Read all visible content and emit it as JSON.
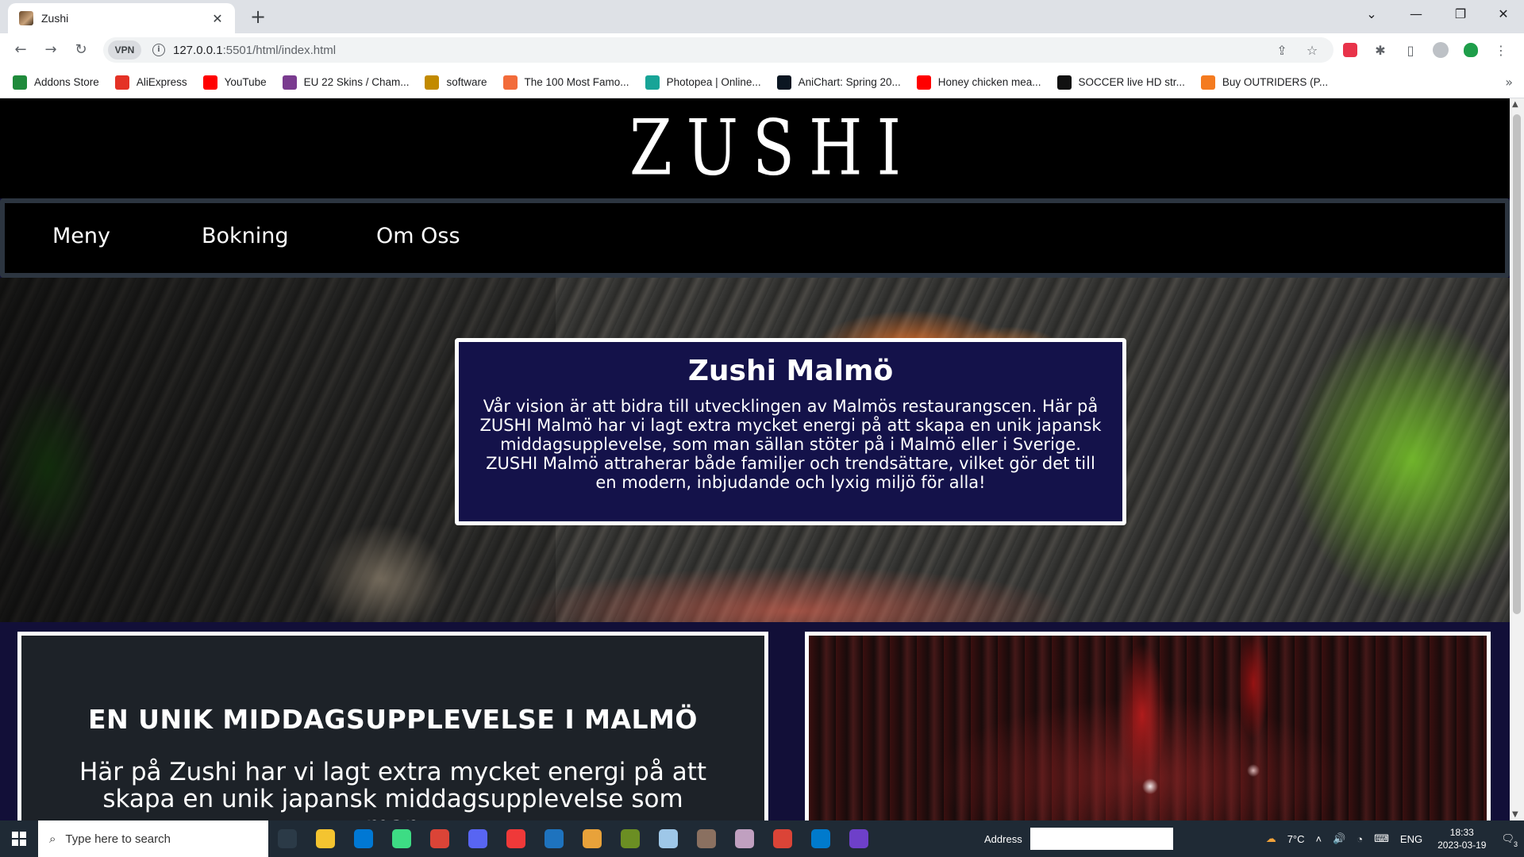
{
  "browser": {
    "tab_title": "Zushi",
    "tab_close": "✕",
    "new_tab": "+",
    "url_host": "127.0.0.1",
    "url_rest": ":5501/html/index.html",
    "vpn_label": "VPN",
    "bookmarks": [
      {
        "label": "Addons Store",
        "color": "#1f8a3b"
      },
      {
        "label": "AliExpress",
        "color": "#e43226"
      },
      {
        "label": "YouTube",
        "color": "#ff0000"
      },
      {
        "label": "EU 22 Skins / Cham...",
        "color": "#7a3b8f"
      },
      {
        "label": "software",
        "color": "#c28a00"
      },
      {
        "label": "The 100 Most Famo...",
        "color": "#f26b3a"
      },
      {
        "label": "Photopea | Online...",
        "color": "#18a497"
      },
      {
        "label": "AniChart: Spring 20...",
        "color": "#0b1622"
      },
      {
        "label": "Honey chicken mea...",
        "color": "#ff0000"
      },
      {
        "label": "SOCCER live HD str...",
        "color": "#111111"
      },
      {
        "label": "Buy OUTRIDERS (P...",
        "color": "#f47b20"
      }
    ]
  },
  "site": {
    "logo": "ZUSHI",
    "nav": [
      "Meny",
      "Bokning",
      "Om Oss"
    ],
    "hero": {
      "title": "Zushi Malmö",
      "text": "Vår vision är att bidra till utvecklingen av Malmös restaurangscen. Här på ZUSHI Malmö har vi lagt extra mycket energi på att skapa en unik japansk middagsupplevelse, som man sällan stöter på i Malmö eller i Sverige. ZUSHI Malmö attraherar både familjer och trendsättare, vilket gör det till en modern, inbjudande och lyxig miljö för alla!"
    },
    "about": {
      "title": "EN UNIK MIDDAGSUPPLEVELSE I MALMÖ",
      "text": "Här på Zushi har vi lagt extra mycket energi på att skapa en unik japansk middagsupplevelse som man"
    }
  },
  "taskbar": {
    "search_placeholder": "Type here to search",
    "address_label": "Address",
    "weather": "7°C",
    "lang": "ENG",
    "time": "18:33",
    "date": "2023-03-19",
    "notifications": "3",
    "apps": [
      {
        "name": "task-view",
        "color": "#2b3a47"
      },
      {
        "name": "file-explorer",
        "color": "#f4c430"
      },
      {
        "name": "store",
        "color": "#0078d4"
      },
      {
        "name": "android-studio",
        "color": "#3ddc84"
      },
      {
        "name": "chrome",
        "color": "#db4437"
      },
      {
        "name": "discord",
        "color": "#5865f2"
      },
      {
        "name": "vivaldi",
        "color": "#ef3939"
      },
      {
        "name": "bitdefender",
        "color": "#1e73be"
      },
      {
        "name": "browser-active",
        "color": "#e8a23a"
      },
      {
        "name": "minecraft",
        "color": "#6b8e23"
      },
      {
        "name": "notepad",
        "color": "#9ec7e8"
      },
      {
        "name": "game",
        "color": "#8a7060"
      },
      {
        "name": "character",
        "color": "#c0a0c0"
      },
      {
        "name": "chrome-2",
        "color": "#db4437"
      },
      {
        "name": "vscode",
        "color": "#007acc"
      },
      {
        "name": "github",
        "color": "#6e40c9"
      }
    ]
  }
}
